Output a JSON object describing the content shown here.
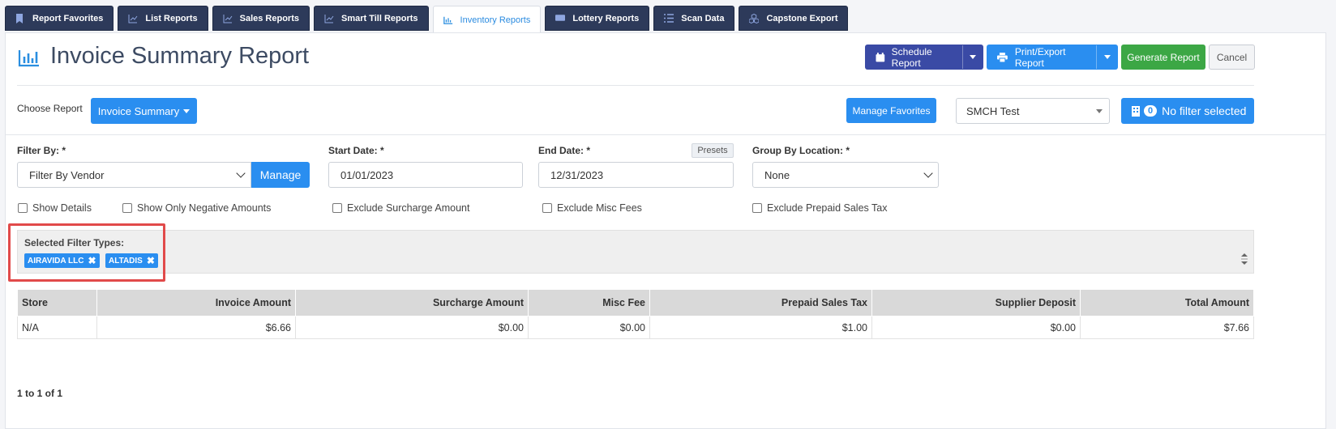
{
  "tabs": [
    {
      "label": "Report Favorites",
      "icon": "bookmark-icon",
      "active": false
    },
    {
      "label": "List Reports",
      "icon": "line-chart-icon",
      "active": false
    },
    {
      "label": "Sales Reports",
      "icon": "line-chart-icon",
      "active": false
    },
    {
      "label": "Smart Till Reports",
      "icon": "line-chart-icon",
      "active": false
    },
    {
      "label": "Inventory Reports",
      "icon": "inventory-icon",
      "active": true
    },
    {
      "label": "Lottery Reports",
      "icon": "ticket-icon",
      "active": false
    },
    {
      "label": "Scan Data",
      "icon": "list-icon",
      "active": false
    },
    {
      "label": "Capstone Export",
      "icon": "cubes-icon",
      "active": false
    }
  ],
  "header": {
    "title": "Invoice Summary Report",
    "schedule_label": "Schedule Report",
    "print_label": "Print/Export Report",
    "generate_label": "Generate Report",
    "cancel_label": "Cancel"
  },
  "choose": {
    "label": "Choose Report",
    "report": "Invoice Summary",
    "manage_favorites": "Manage Favorites",
    "store": "SMCH Test",
    "filter_count": "0",
    "filter_label": "No filter selected"
  },
  "filters": {
    "filter_by_label": "Filter By: *",
    "filter_by_value": "Filter By Vendor",
    "manage_label": "Manage",
    "start_label": "Start Date: *",
    "start_value": "01/01/2023",
    "end_label": "End Date: *",
    "end_value": "12/31/2023",
    "presets_label": "Presets",
    "group_label": "Group By Location: *",
    "group_value": "None"
  },
  "checkboxes": [
    "Show Details",
    "Show Only Negative Amounts",
    "Exclude Surcharge Amount",
    "Exclude Misc Fees",
    "Exclude Prepaid Sales Tax"
  ],
  "selected_filters": {
    "title": "Selected Filter Types:",
    "chips": [
      "AIRAVIDA LLC",
      "ALTADIS"
    ]
  },
  "table": {
    "columns": [
      "Store",
      "Invoice Amount",
      "Surcharge Amount",
      "Misc Fee",
      "Prepaid Sales Tax",
      "Supplier Deposit",
      "Total Amount"
    ],
    "rows": [
      [
        "N/A",
        "$6.66",
        "$0.00",
        "$0.00",
        "$1.00",
        "$0.00",
        "$7.66"
      ]
    ]
  },
  "pager": "1 to 1 of 1",
  "colors": {
    "tab_bg": "#2d3a5a",
    "primary": "#2a8ef0",
    "schedule": "#3a4aa5",
    "generate": "#3ca745",
    "highlight": "#e14a4a"
  }
}
